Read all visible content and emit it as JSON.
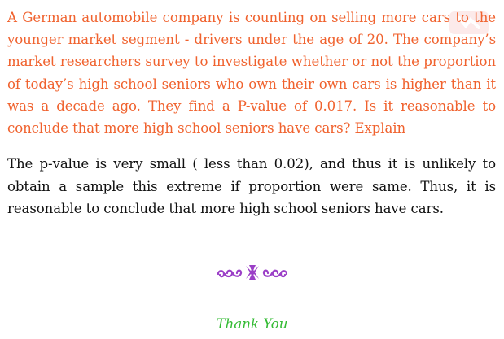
{
  "question": {
    "text": "A German automobile company is counting on selling more cars to the younger market segment - drivers under the age of 20.  The company’s market researchers survey to investigate whether or not the proportion of today’s high school seniors who own their own cars is higher than it was a decade ago.  They find a P-value of 0.017.  Is it reasonable to conclude that more high school seniors have cars?  Explain",
    "color": "#f0622e"
  },
  "answer": {
    "text": "The p-value is very small ( less than 0.02), and thus it is unlikely to obtain a sample this extreme if proportion were same.  Thus, it is reasonable to conclude that more high school seniors have cars."
  },
  "divider": {
    "color": "#b36fd6",
    "ornament_icon": "floral-ornament-icon"
  },
  "closing": {
    "text": "Thank You",
    "color": "#33bb33"
  }
}
